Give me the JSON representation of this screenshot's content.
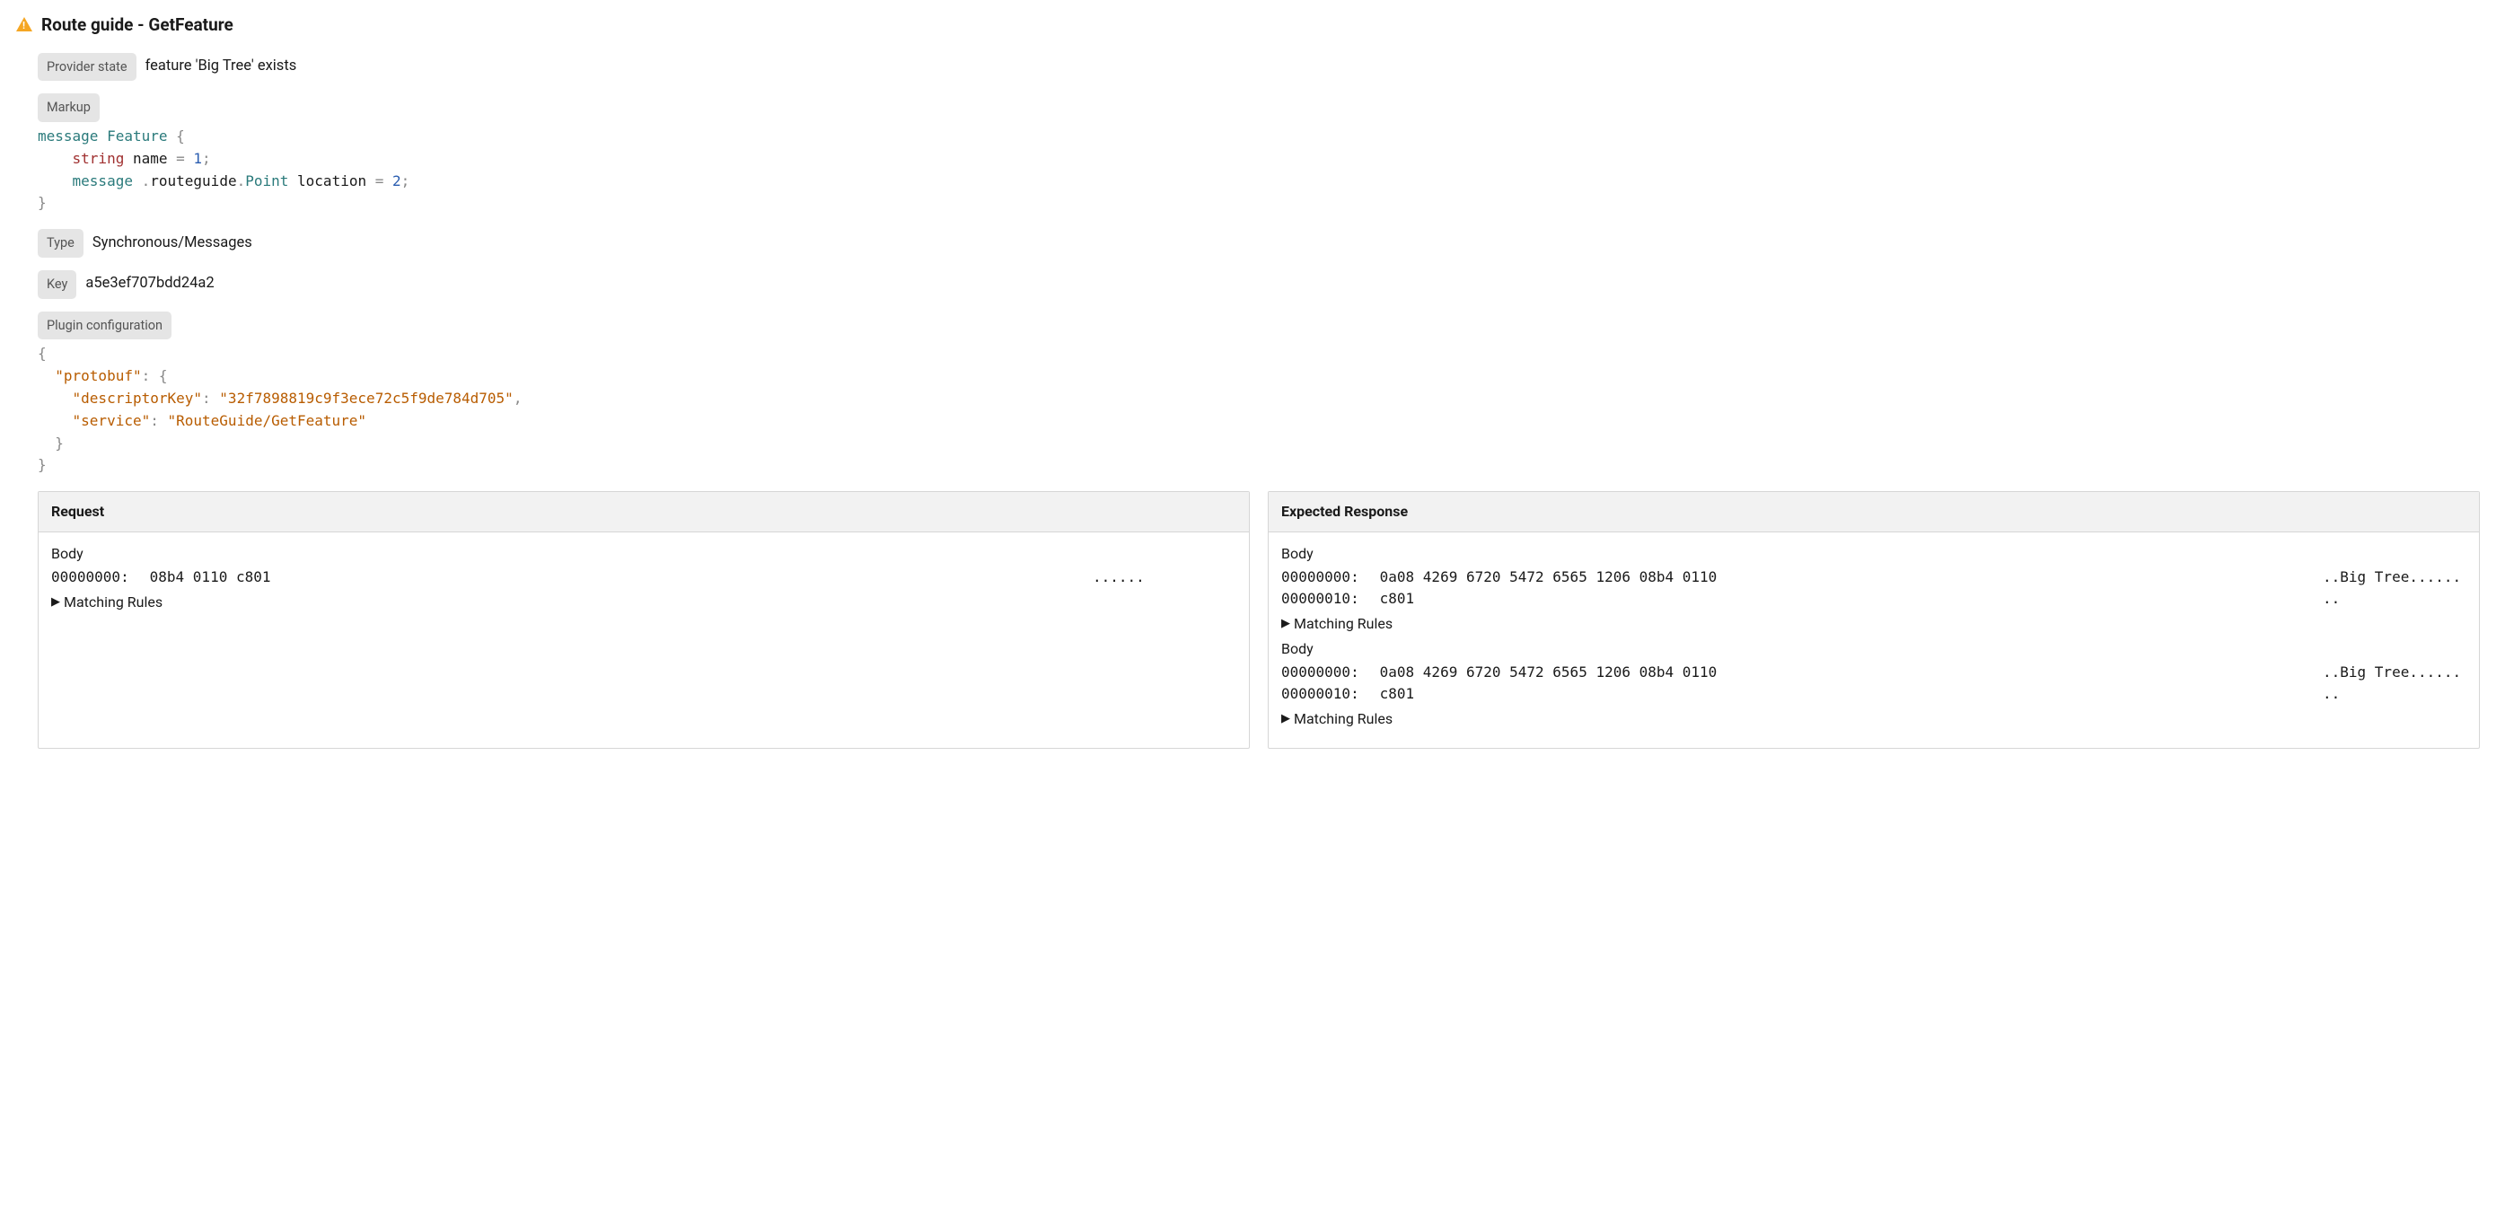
{
  "header": {
    "title": "Route guide - GetFeature"
  },
  "providerState": {
    "label": "Provider state",
    "value": "feature 'Big Tree' exists"
  },
  "markup": {
    "label": "Markup",
    "tokens": {
      "kw_message": "message",
      "type_feature": "Feature",
      "open_brace": " {",
      "indent4": "    ",
      "type_string": "string",
      "field_name": "name",
      "eq": " = ",
      "one": "1",
      "semi": ";",
      "kw_message2": "message",
      "dot1": ".",
      "ns_routeguide": "routeguide",
      "dot2": ".",
      "type_point": "Point",
      "field_location": "location",
      "two": "2",
      "close_brace": "}"
    }
  },
  "type": {
    "label": "Type",
    "value": "Synchronous/Messages"
  },
  "key": {
    "label": "Key",
    "value": "a5e3ef707bdd24a2"
  },
  "pluginConfig": {
    "label": "Plugin configuration",
    "json": {
      "open": "{",
      "indent2": "  ",
      "indent4": "    ",
      "k_protobuf": "\"protobuf\"",
      "colon": ": ",
      "open2": "{",
      "k_descriptor": "\"descriptorKey\"",
      "v_descriptor": "\"32f7898819c9f3ece72c5f9de784d705\"",
      "comma": ",",
      "k_service": "\"service\"",
      "v_service": "\"RouteGuide/GetFeature\"",
      "close2": "}",
      "close": "}"
    }
  },
  "request": {
    "title": "Request",
    "bodyLabel": "Body",
    "hex": [
      {
        "offset": "00000000:",
        "bytes": " 08b4 0110 c801                           ",
        "ascii": "......"
      }
    ],
    "matchingRules": "Matching Rules"
  },
  "response": {
    "title": "Expected Response",
    "sections": [
      {
        "bodyLabel": "Body",
        "hex": [
          {
            "offset": "00000000:",
            "bytes": " 0a08 4269 6720 5472 6565 1206 08b4 0110  ",
            "ascii": "..Big Tree......"
          },
          {
            "offset": "00000010:",
            "bytes": " c801                                     ",
            "ascii": ".."
          }
        ],
        "matchingRules": "Matching Rules"
      },
      {
        "bodyLabel": "Body",
        "hex": [
          {
            "offset": "00000000:",
            "bytes": " 0a08 4269 6720 5472 6565 1206 08b4 0110  ",
            "ascii": "..Big Tree......"
          },
          {
            "offset": "00000010:",
            "bytes": " c801                                     ",
            "ascii": ".."
          }
        ],
        "matchingRules": "Matching Rules"
      }
    ]
  }
}
